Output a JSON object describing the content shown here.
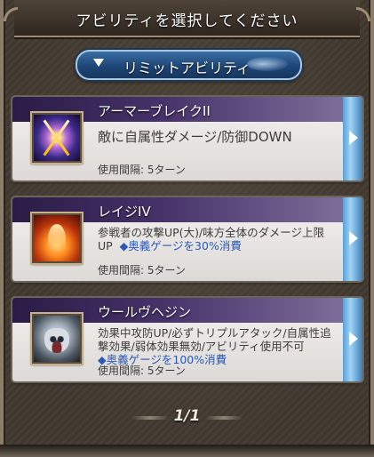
{
  "header": {
    "title": "アビリティを選択してください"
  },
  "tab": {
    "label": "リミットアビリティ"
  },
  "abilities": [
    {
      "name": "アーマーブレイクII",
      "description": "敵に自属性ダメージ/防御DOWN",
      "cost": "",
      "cooldown": "使用間隔: 5ターン",
      "icon": "armor-break-icon"
    },
    {
      "name": "レイジIV",
      "description": "参戦者の攻撃UP(大)/味方全体のダメージ上限UP",
      "cost": "◆奥義ゲージを30%消費",
      "cooldown": "使用間隔: 5ターン",
      "icon": "rage-icon"
    },
    {
      "name": "ウールヴヘジン",
      "description": "効果中攻防UP/必ずトリプルアタック/自属性追撃効果/弱体効果無効/アビリティ使用不可",
      "cost": "◆奥義ゲージを100%消費",
      "cooldown": "使用間隔: 5ターン",
      "icon": "wolf-icon"
    }
  ],
  "pager": {
    "text": "1/1"
  },
  "colors": {
    "accent": "#1e4677",
    "cost_text": "#2a59b8",
    "name_band": "#463269"
  }
}
